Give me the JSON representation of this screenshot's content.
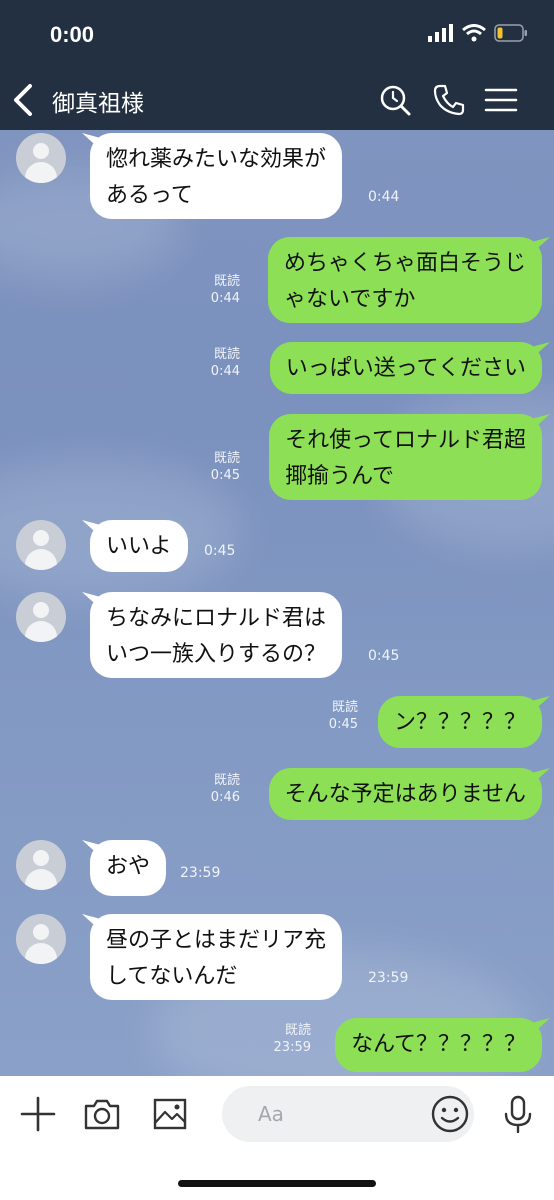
{
  "status_bar": {
    "time": "0:00"
  },
  "header": {
    "title": "御真祖様"
  },
  "messages": [
    {
      "text_lines": [
        "惚れ薬みたいな効果が",
        "あるって"
      ],
      "time": "0:44"
    },
    {
      "text_lines": [
        "めちゃくちゃ面白そうじ",
        "ゃないですか"
      ],
      "read": "既読",
      "time": "0:44"
    },
    {
      "text_lines": [
        "いっぱい送ってください"
      ],
      "read": "既読",
      "time": "0:44"
    },
    {
      "text_lines": [
        "それ使ってロナルド君超",
        "揶揄うんで"
      ],
      "read": "既読",
      "time": "0:45"
    },
    {
      "text_lines": [
        "いいよ"
      ],
      "time": "0:45"
    },
    {
      "text_lines": [
        "ちなみにロナルド君は",
        "いつ一族入りするの？"
      ],
      "time": "0:45"
    },
    {
      "text_lines": [
        "ン？？？？？"
      ],
      "read": "既読",
      "time": "0:45"
    },
    {
      "text_lines": [
        "そんな予定はありません"
      ],
      "read": "既読",
      "time": "0:46"
    },
    {
      "text_lines": [
        "おや"
      ],
      "time": "23:59"
    },
    {
      "text_lines": [
        "昼の子とはまだリア充",
        "してないんだ"
      ],
      "time": "23:59"
    },
    {
      "text_lines": [
        "なんて？？？？？"
      ],
      "read": "既読",
      "time": "23:59"
    }
  ],
  "input_bar": {
    "placeholder": "Aa"
  },
  "icons": {
    "status": [
      "signal-icon",
      "wifi-icon",
      "battery-icon"
    ],
    "header": [
      "back-icon",
      "search-icon",
      "phone-icon",
      "menu-icon"
    ],
    "input": [
      "plus-icon",
      "camera-icon",
      "image-icon",
      "emoji-icon",
      "mic-icon"
    ]
  },
  "colors": {
    "header_bg": "#233042",
    "sent_bubble": "#8de055",
    "received_bubble": "#ffffff",
    "chat_bg": "#7f94bf",
    "battery_level": "#f2c230"
  }
}
